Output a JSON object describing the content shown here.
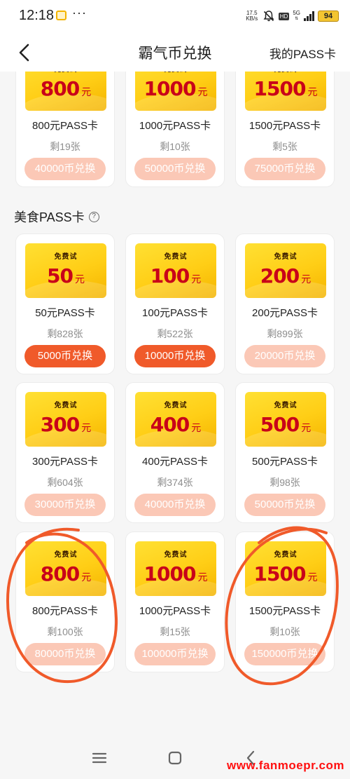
{
  "status_bar": {
    "time": "12:18",
    "dots": "···",
    "net_speed_value": "17.5",
    "net_speed_unit": "KB/s",
    "hd": "HD",
    "network": "5G",
    "battery": "94"
  },
  "nav": {
    "title": "霸气币兑换",
    "right_link": "我的PASS卡"
  },
  "coupon_tag": "免费试",
  "coupon_unit": "元",
  "top_row": [
    {
      "amount": "800",
      "title": "800元PASS卡",
      "stock": "剩19张",
      "button": "40000币兑换",
      "active": false
    },
    {
      "amount": "1000",
      "title": "1000元PASS卡",
      "stock": "剩10张",
      "button": "50000币兑换",
      "active": false
    },
    {
      "amount": "1500",
      "title": "1500元PASS卡",
      "stock": "剩5张",
      "button": "75000币兑换",
      "active": false
    }
  ],
  "food_section": {
    "title": "美食PASS卡",
    "help_icon": "question-circle-icon",
    "cards": [
      {
        "amount": "50",
        "title": "50元PASS卡",
        "stock": "剩828张",
        "button": "5000币兑换",
        "active": true
      },
      {
        "amount": "100",
        "title": "100元PASS卡",
        "stock": "剩522张",
        "button": "10000币兑换",
        "active": true
      },
      {
        "amount": "200",
        "title": "200元PASS卡",
        "stock": "剩899张",
        "button": "20000币兑换",
        "active": false
      },
      {
        "amount": "300",
        "title": "300元PASS卡",
        "stock": "剩604张",
        "button": "30000币兑换",
        "active": false
      },
      {
        "amount": "400",
        "title": "400元PASS卡",
        "stock": "剩374张",
        "button": "40000币兑换",
        "active": false
      },
      {
        "amount": "500",
        "title": "500元PASS卡",
        "stock": "剩98张",
        "button": "50000币兑换",
        "active": false
      },
      {
        "amount": "800",
        "title": "800元PASS卡",
        "stock": "剩100张",
        "button": "80000币兑换",
        "active": false
      },
      {
        "amount": "1000",
        "title": "1000元PASS卡",
        "stock": "剩15张",
        "button": "100000币兑换",
        "active": false
      },
      {
        "amount": "1500",
        "title": "1500元PASS卡",
        "stock": "剩10张",
        "button": "150000币兑换",
        "active": false
      }
    ]
  },
  "colors": {
    "accent": "#f05a2a",
    "accent_disabled": "#fbc8b6",
    "coupon_gold": "#ffce16",
    "coupon_text": "#c8001a",
    "annotation": "#f05a2a"
  },
  "bottom_nav": {
    "menu_icon": "menu-icon",
    "home_icon": "home-square-icon",
    "back_icon": "back-chevron-icon"
  },
  "watermark": "www.fanmoepr.com"
}
